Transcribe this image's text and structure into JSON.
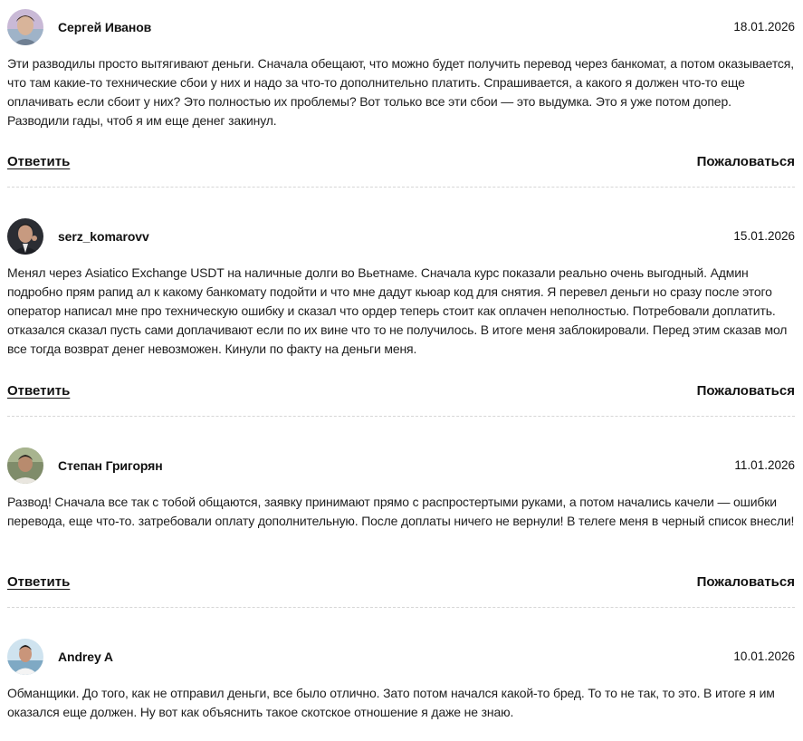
{
  "comments": [
    {
      "author": "Сергей Иванов",
      "date": "18.01.2026",
      "text": "Эти разводилы просто вытягивают деньги. Сначала обещают, что можно будет получить перевод через банкомат, а потом оказывается, что там какие-то технические сбои у них и надо за что-то дополнительно платить. Спрашивается, а какого я должен что-то еще оплачивать если сбоит у них? Это полностью их проблемы? Вот только все эти сбои — это выдумка. Это я уже потом допер. Разводили гады, чтоб я им еще денег закинул.",
      "reply": "Ответить",
      "report": "Пожаловаться"
    },
    {
      "author": "serz_komarovv",
      "date": "15.01.2026",
      "text": "Менял через Asiatico Exchange USDT на наличные долги во Вьетнаме. Сначала курс показали реально очень выгодный. Админ подробно прям рапид ал к какому банкомату подойти и что мне дадут кьюар код для снятия. Я перевел деньги но сразу после этого оператор написал мне про техническую ошибку и сказал что ордер теперь стоит как оплачен неполностью. Потребовали доплатить. отказался сказал пусть сами доплачивают если по их вине что то не получилось. В итоге меня заблокировали. Перед этим сказав мол все тогда возврат денег невозможен. Кинули по факту на деньги меня.",
      "reply": "Ответить",
      "report": "Пожаловаться"
    },
    {
      "author": "Степан Григорян",
      "date": "11.01.2026",
      "text": "Развод! Сначала все так с тобой общаются, заявку принимают прямо с распростертыми руками, а потом начались качели — ошибки перевода, еще что-то. затребовали оплату дополнительную. После доплаты ничего не вернули! В телеге меня в черный список внесли!",
      "reply": "Ответить",
      "report": "Пожаловаться"
    },
    {
      "author": "Andrey A",
      "date": "10.01.2026",
      "text": "Обманщики. До того, как не отправил деньги, все было отлично. Зато потом начался какой-то бред. То то не так, то это. В итоге я им оказался еще должен. Ну вот как объяснить такое скотское отношение я даже не знаю."
    }
  ]
}
